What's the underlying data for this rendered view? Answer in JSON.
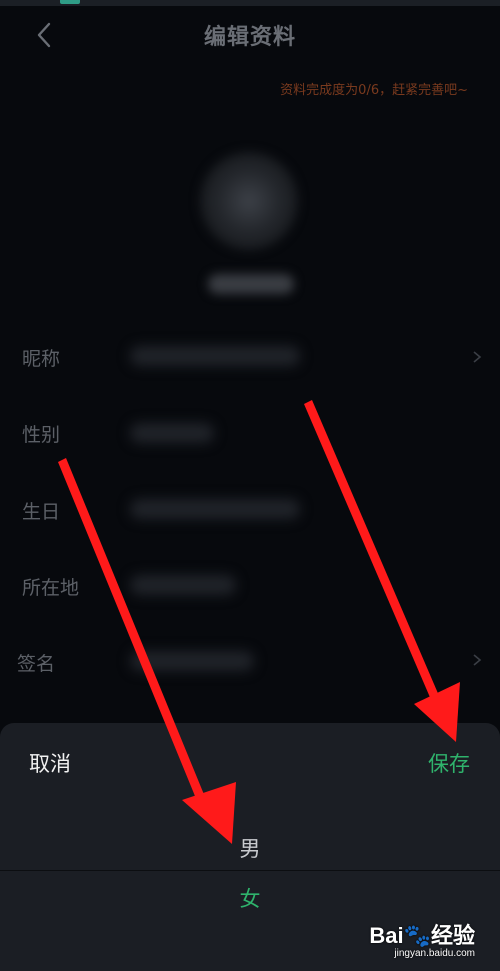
{
  "header": {
    "title": "编辑资料",
    "back_icon": "chevron-left-icon"
  },
  "profile": {
    "completion_text": "资料完成度为0/6，赶紧完善吧~"
  },
  "rows": [
    {
      "label": "昵称",
      "has_arrow": true
    },
    {
      "label": "性别",
      "has_arrow": false
    },
    {
      "label": "生日",
      "has_arrow": false
    },
    {
      "label": "所在地",
      "has_arrow": false
    },
    {
      "label": "签名",
      "has_arrow": true
    }
  ],
  "sheet": {
    "cancel_label": "取消",
    "save_label": "保存",
    "options": [
      "男",
      "女"
    ],
    "selected": "女"
  },
  "watermark": {
    "logo": "Bai🐾经验",
    "url": "jingyan.baidu.com"
  },
  "colors": {
    "background": "#07090d",
    "sheet": "#1b1e24",
    "accent_green": "#2fb36c",
    "completion_text": "#7a3a1e",
    "annotation_arrow": "#ff1a1a"
  }
}
